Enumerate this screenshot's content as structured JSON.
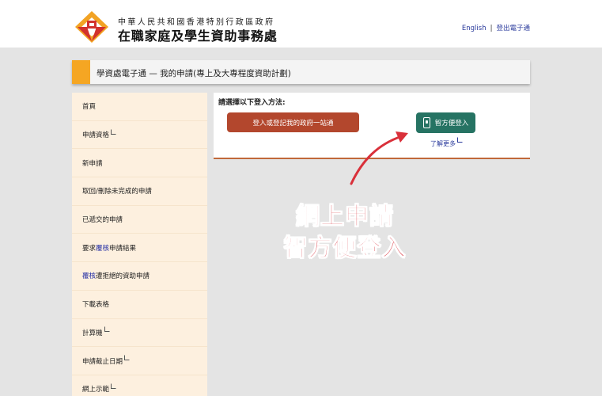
{
  "header": {
    "logo_icon": "ssfa-logo-icon",
    "dept_subtitle": "中華人民共和國香港特別行政區政府",
    "dept_title": "在職家庭及學生資助事務處",
    "links": {
      "english": "English",
      "separator": "|",
      "logout": "登出電子通"
    }
  },
  "page": {
    "title": "學資處電子通 — 我的申請(專上及大專程度資助計劃)",
    "accent_color": "#f5a623"
  },
  "sidebar": {
    "items": [
      {
        "pre": "首頁",
        "hl": "",
        "post": "",
        "external": false
      },
      {
        "pre": "申請資格",
        "hl": "",
        "post": "",
        "external": true
      },
      {
        "pre": "新申請",
        "hl": "",
        "post": "",
        "external": false
      },
      {
        "pre": "取回/刪除未完成的申請",
        "hl": "",
        "post": "",
        "external": false
      },
      {
        "pre": "已遞交的申請",
        "hl": "",
        "post": "",
        "external": false
      },
      {
        "pre": "要求",
        "hl": "覆核",
        "post": "申請結果",
        "external": false
      },
      {
        "pre": "",
        "hl": "覆核",
        "post": "遭拒絕的資助申請",
        "external": false
      },
      {
        "pre": "下載表格",
        "hl": "",
        "post": "",
        "external": false
      },
      {
        "pre": "計算機",
        "hl": "",
        "post": "",
        "external": true
      },
      {
        "pre": "申請截止日期",
        "hl": "",
        "post": "",
        "external": true
      },
      {
        "pre": "網上示範",
        "hl": "",
        "post": "",
        "external": true
      }
    ]
  },
  "login": {
    "prompt": "請選擇以下登入方法:",
    "gov_button": "登入或登記我的政府一站通",
    "iamsmart_button": "智方便登入",
    "iamsmart_icon": "phone-icon",
    "learn_more": "了解更多",
    "gov_color": "#b3472d",
    "iamsmart_color": "#267363"
  },
  "annotation": {
    "line1": "網上申請",
    "line2": "智方便登入",
    "color": "#d9303a"
  }
}
